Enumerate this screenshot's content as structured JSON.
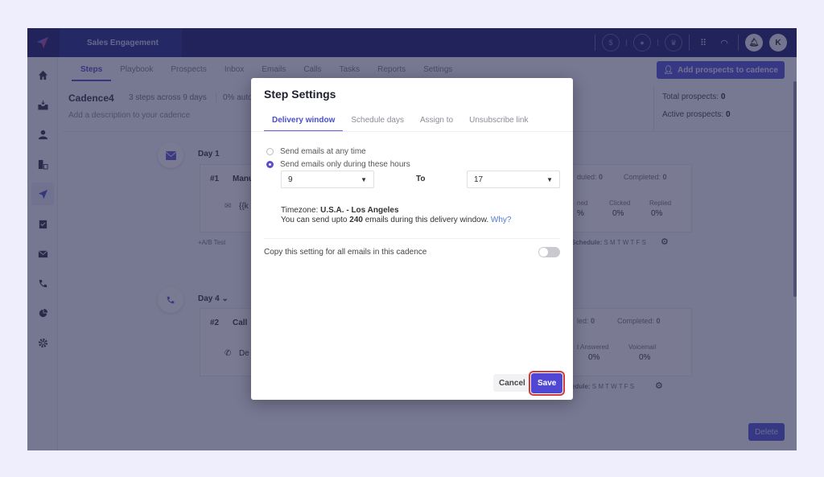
{
  "app": {
    "title": "Sales Engagement",
    "user_initial": "K",
    "accent_color": "#4d4fd6",
    "topbar_color": "#151a6b"
  },
  "topbar_icons": [
    "dollar-circle-icon",
    "user-circle-icon",
    "crown-circle-icon",
    "dialpad-icon",
    "headset-icon",
    "bell-icon"
  ],
  "sidebar": {
    "items": [
      {
        "name": "home-icon",
        "glyph": "⌂"
      },
      {
        "name": "inbox-tray-icon",
        "glyph": "⬓"
      },
      {
        "name": "person-icon",
        "glyph": "●"
      },
      {
        "name": "building-icon",
        "glyph": "▥"
      },
      {
        "name": "send-icon",
        "glyph": "➤",
        "active": true
      },
      {
        "name": "clipboard-check-icon",
        "glyph": "▣"
      },
      {
        "name": "envelope-icon",
        "glyph": "✉"
      },
      {
        "name": "phone-icon",
        "glyph": "✆"
      },
      {
        "name": "pie-chart-icon",
        "glyph": "◔"
      },
      {
        "name": "gear-icon",
        "glyph": "⚙"
      }
    ]
  },
  "tabs": [
    "Steps",
    "Playbook",
    "Prospects",
    "Inbox",
    "Emails",
    "Calls",
    "Tasks",
    "Reports",
    "Settings"
  ],
  "active_tab": "Steps",
  "add_prospects_label": "Add prospects to cadence",
  "cadence": {
    "name": "Cadence4",
    "steps_summary": "3 steps across 9 days",
    "automation": "0% auto",
    "description_placeholder": "Add a description to your cadence",
    "total_prospects_label": "Total prospects:",
    "total_prospects": "0",
    "active_prospects_label": "Active prospects:",
    "active_prospects": "0"
  },
  "steps": [
    {
      "day": "Day 1",
      "number": "#1",
      "type": "Manu",
      "subject": "{{k",
      "scheduled_label": "duled:",
      "scheduled": "0",
      "completed_label": "Completed:",
      "completed": "0",
      "metrics": [
        {
          "label": "ned",
          "value": "%"
        },
        {
          "label": "Clicked",
          "value": "0%"
        },
        {
          "label": "Replied",
          "value": "0%"
        }
      ],
      "schedule_label": "Schedule:",
      "schedule_days": "S M T W T F S",
      "ab_test": "+A/B Test"
    },
    {
      "day": "Day 4",
      "number": "#2",
      "type": "Call",
      "subject": "De",
      "scheduled_label": "led:",
      "scheduled": "0",
      "completed_label": "Completed:",
      "completed": "0",
      "metrics": [
        {
          "label": "t Answered",
          "value": "0%"
        },
        {
          "label": "Voicemail",
          "value": "0%"
        }
      ],
      "schedule_label": "edule:",
      "schedule_days": "S M T W T F S"
    }
  ],
  "delete_label": "Delete",
  "modal": {
    "title": "Step Settings",
    "tabs": [
      "Delivery window",
      "Schedule days",
      "Assign to",
      "Unsubscribe link"
    ],
    "active_tab": "Delivery window",
    "options": [
      {
        "label": "Send emails at any time",
        "selected": false
      },
      {
        "label": "Send emails only during these hours",
        "selected": true
      }
    ],
    "from_hour": "9",
    "to_label": "To",
    "to_hour": "17",
    "timezone_label": "Timezone:",
    "timezone": "U.S.A. - Los Angeles",
    "quota_prefix": "You can send upto",
    "quota_count": "240",
    "quota_suffix": "emails during this delivery window.",
    "why_link": "Why?",
    "copy_setting_label": "Copy this setting for all emails in this cadence",
    "copy_setting_enabled": false,
    "cancel_label": "Cancel",
    "save_label": "Save"
  }
}
